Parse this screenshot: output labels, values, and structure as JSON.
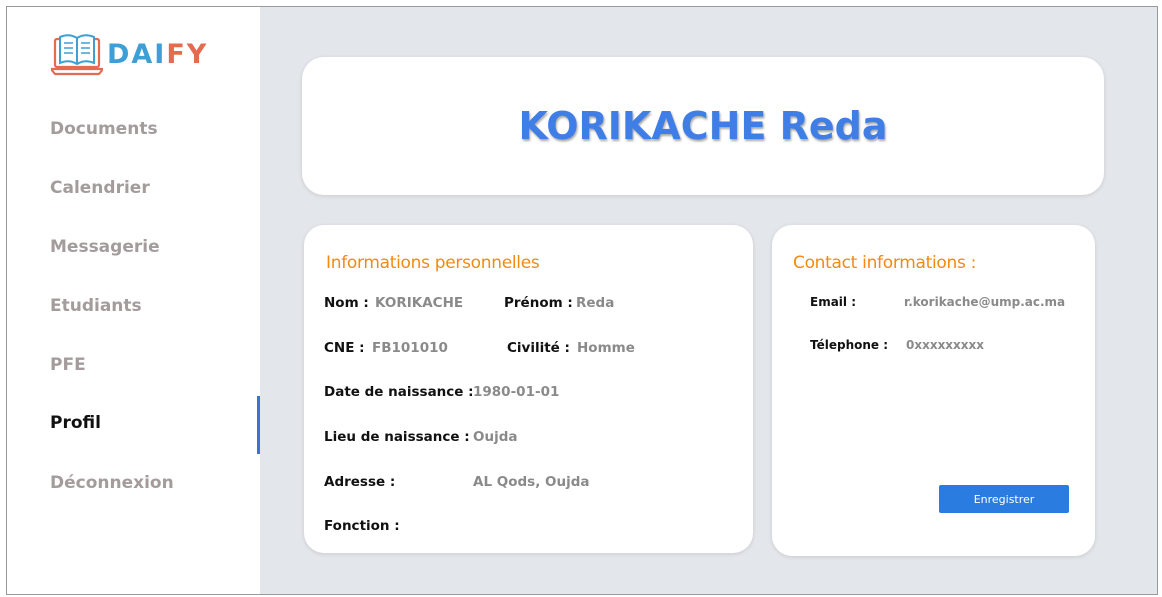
{
  "brand": {
    "name_part1": "DAI",
    "name_part2": "FY",
    "color_primary": "#3d9fd6",
    "color_secondary": "#e56b50",
    "icon": "book-laptop-icon"
  },
  "sidebar": {
    "active_item": "Profil",
    "items": [
      {
        "label": "Documents"
      },
      {
        "label": "Calendrier"
      },
      {
        "label": "Messagerie"
      },
      {
        "label": "Etudiants"
      },
      {
        "label": "PFE"
      },
      {
        "label": "Profil"
      },
      {
        "label": "Déconnexion"
      }
    ]
  },
  "profile": {
    "full_name": "KORIKACHE Reda"
  },
  "personal_info": {
    "heading": "Informations personnelles",
    "nom_label": "Nom :",
    "nom_value": "KORIKACHE",
    "prenom_label": "Prénom :",
    "prenom_value": "Reda",
    "cne_label": "CNE :",
    "cne_value": "FB101010",
    "civilite_label": "Civilité :",
    "civilite_value": "Homme",
    "date_naissance_label": "Date de naissance :",
    "date_naissance_value": "1980-01-01",
    "lieu_naissance_label": "Lieu de naissance :",
    "lieu_naissance_value": "Oujda",
    "adresse_label": "Adresse :",
    "adresse_value": "AL Qods, Oujda",
    "fonction_label": "Fonction :",
    "fonction_value": ""
  },
  "contact_info": {
    "heading": "Contact informations :",
    "email_label": "Email :",
    "email_value": "r.korikache@ump.ac.ma",
    "telephone_label": "Télephone :",
    "telephone_value": "0xxxxxxxxx",
    "save_label": "Enregistrer"
  },
  "colors": {
    "accent_blue": "#3f7ee6",
    "heading_orange": "#f28a10",
    "active_indicator": "#3a72d6",
    "background": "#e3e6ea"
  }
}
